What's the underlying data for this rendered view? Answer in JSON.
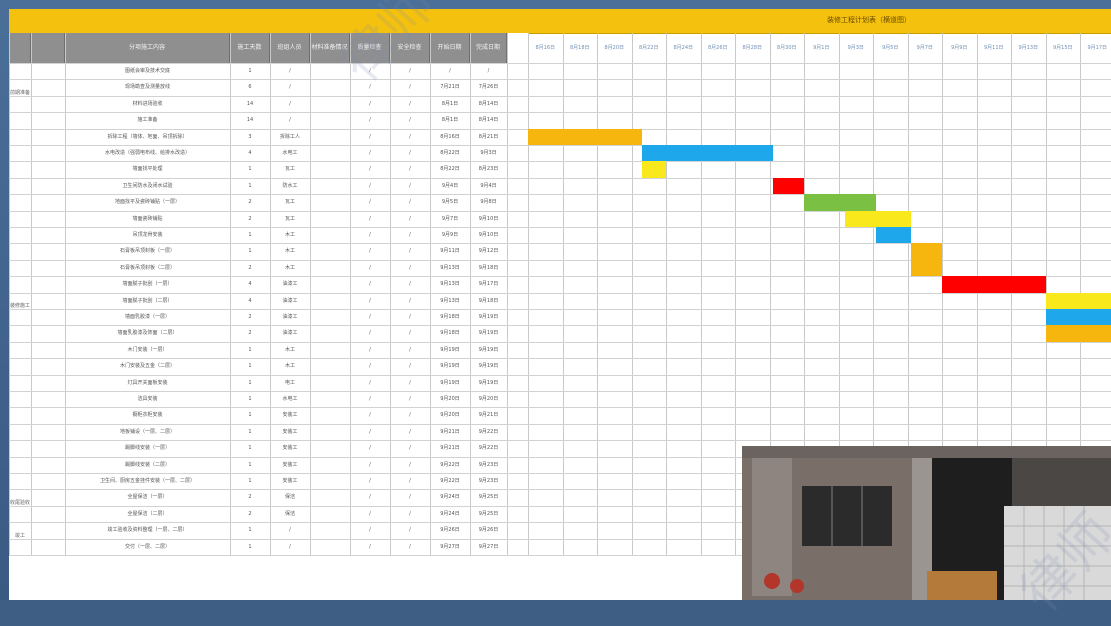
{
  "sheet": {
    "title": "装修工程计划表（横道图）",
    "columns": [
      "",
      "",
      "分项施工内容",
      "施工天数",
      "班组人员",
      "材料准备情况",
      "质量检查",
      "安全检查",
      "开始日期",
      "完成日期"
    ],
    "dates": [
      "8月16日",
      "8月18日",
      "8月20日",
      "8月22日",
      "8月24日",
      "8月26日",
      "8月28日",
      "8月30日",
      "9月1日",
      "9月3日",
      "9月5日",
      "9月7日",
      "9月9日",
      "9月11日",
      "9月13日",
      "9月15日",
      "9月17日"
    ],
    "groups": [
      {
        "label": "前期准备",
        "rows": 4
      },
      {
        "label": "装修施工",
        "rows": 22
      },
      {
        "label": "收尾验收",
        "rows": 2
      },
      {
        "label": "竣工",
        "rows": 2
      }
    ],
    "rows": [
      {
        "task": "图纸会审及技术交底",
        "days": "1",
        "crew": "/",
        "mat": "",
        "q": "/",
        "s": "/",
        "start": "/",
        "end": "/"
      },
      {
        "task": "现场勘查及测量放线",
        "days": "6",
        "crew": "/",
        "mat": "",
        "q": "/",
        "s": "/",
        "start": "7月21日",
        "end": "7月26日"
      },
      {
        "task": "材料进场验收",
        "days": "14",
        "crew": "/",
        "mat": "",
        "q": "/",
        "s": "/",
        "start": "8月1日",
        "end": "8月14日"
      },
      {
        "task": "施工准备",
        "days": "14",
        "crew": "/",
        "mat": "",
        "q": "/",
        "s": "/",
        "start": "8月1日",
        "end": "8月14日"
      },
      {
        "task": "拆除工程（墙体、地面、吊顶拆除）",
        "days": "3",
        "crew": "拆除工人",
        "mat": "",
        "q": "/",
        "s": "/",
        "start": "8月16日",
        "end": "8月21日"
      },
      {
        "task": "水电改造（强弱电布线、给排水改造）",
        "days": "4",
        "crew": "水电工",
        "mat": "",
        "q": "/",
        "s": "/",
        "start": "8月22日",
        "end": "9月3日"
      },
      {
        "task": "墙面找平处理",
        "days": "1",
        "crew": "瓦工",
        "mat": "",
        "q": "/",
        "s": "/",
        "start": "8月22日",
        "end": "8月23日"
      },
      {
        "task": "卫生间防水及闭水试验",
        "days": "1",
        "crew": "防水工",
        "mat": "",
        "q": "/",
        "s": "/",
        "start": "9月4日",
        "end": "9月4日"
      },
      {
        "task": "地面找平及瓷砖铺贴（一层）",
        "days": "2",
        "crew": "瓦工",
        "mat": "",
        "q": "/",
        "s": "/",
        "start": "9月5日",
        "end": "9月8日"
      },
      {
        "task": "墙面瓷砖铺贴",
        "days": "2",
        "crew": "瓦工",
        "mat": "",
        "q": "/",
        "s": "/",
        "start": "9月7日",
        "end": "9月10日"
      },
      {
        "task": "吊顶龙骨安装",
        "days": "1",
        "crew": "木工",
        "mat": "",
        "q": "/",
        "s": "/",
        "start": "9月9日",
        "end": "9月10日"
      },
      {
        "task": "石膏板吊顶封板（一层）",
        "days": "1",
        "crew": "木工",
        "mat": "",
        "q": "/",
        "s": "/",
        "start": "9月11日",
        "end": "9月12日"
      },
      {
        "task": "石膏板吊顶封板（二层）",
        "days": "2",
        "crew": "木工",
        "mat": "",
        "q": "/",
        "s": "/",
        "start": "9月13日",
        "end": "9月18日"
      },
      {
        "task": "墙面腻子批刮（一层）",
        "days": "4",
        "crew": "油漆工",
        "mat": "",
        "q": "/",
        "s": "/",
        "start": "9月13日",
        "end": "9月17日"
      },
      {
        "task": "墙面腻子批刮（二层）",
        "days": "4",
        "crew": "油漆工",
        "mat": "",
        "q": "/",
        "s": "/",
        "start": "9月13日",
        "end": "9月18日"
      },
      {
        "task": "墙面乳胶漆（一层）",
        "days": "2",
        "crew": "油漆工",
        "mat": "",
        "q": "/",
        "s": "/",
        "start": "9月18日",
        "end": "9月19日"
      },
      {
        "task": "墙面乳胶漆及饰面（二层）",
        "days": "2",
        "crew": "油漆工",
        "mat": "",
        "q": "/",
        "s": "/",
        "start": "9月18日",
        "end": "9月19日"
      },
      {
        "task": "木门安装（一层）",
        "days": "1",
        "crew": "木工",
        "mat": "",
        "q": "/",
        "s": "/",
        "start": "9月19日",
        "end": "9月19日"
      },
      {
        "task": "木门安装及五金（二层）",
        "days": "1",
        "crew": "木工",
        "mat": "",
        "q": "/",
        "s": "/",
        "start": "9月19日",
        "end": "9月19日"
      },
      {
        "task": "灯具开关面板安装",
        "days": "1",
        "crew": "电工",
        "mat": "",
        "q": "/",
        "s": "/",
        "start": "9月19日",
        "end": "9月19日"
      },
      {
        "task": "洁具安装",
        "days": "1",
        "crew": "水电工",
        "mat": "",
        "q": "/",
        "s": "/",
        "start": "9月20日",
        "end": "9月20日"
      },
      {
        "task": "橱柜衣柜安装",
        "days": "1",
        "crew": "安装工",
        "mat": "",
        "q": "/",
        "s": "/",
        "start": "9月20日",
        "end": "9月21日"
      },
      {
        "task": "地板铺设（一层、二层）",
        "days": "1",
        "crew": "安装工",
        "mat": "",
        "q": "/",
        "s": "/",
        "start": "9月21日",
        "end": "9月22日"
      },
      {
        "task": "踢脚线安装（一层）",
        "days": "1",
        "crew": "安装工",
        "mat": "",
        "q": "/",
        "s": "/",
        "start": "9月21日",
        "end": "9月22日"
      },
      {
        "task": "踢脚线安装（二层）",
        "days": "1",
        "crew": "安装工",
        "mat": "",
        "q": "/",
        "s": "/",
        "start": "9月22日",
        "end": "9月23日"
      },
      {
        "task": "卫生间、厨房五金挂件安装（一层、二层）",
        "days": "1",
        "crew": "安装工",
        "mat": "",
        "q": "/",
        "s": "/",
        "start": "9月22日",
        "end": "9月23日"
      },
      {
        "task": "全屋保洁（一层）",
        "days": "2",
        "crew": "保洁",
        "mat": "",
        "q": "/",
        "s": "/",
        "start": "9月24日",
        "end": "9月25日"
      },
      {
        "task": "全屋保洁（二层）",
        "days": "2",
        "crew": "保洁",
        "mat": "",
        "q": "/",
        "s": "/",
        "start": "9月24日",
        "end": "9月25日"
      },
      {
        "task": "竣工验收及资料整理（一层、二层）",
        "days": "1",
        "crew": "/",
        "mat": "",
        "q": "/",
        "s": "/",
        "start": "9月26日",
        "end": "9月26日"
      },
      {
        "task": "交付（一层、二层）",
        "days": "1",
        "crew": "/",
        "mat": "",
        "q": "/",
        "s": "/",
        "start": "9月27日",
        "end": "9月27日"
      }
    ],
    "bars": [
      {
        "row": 4,
        "col_start": 0,
        "cols": 3.3,
        "color": "#f6b60e"
      },
      {
        "row": 5,
        "col_start": 3.3,
        "cols": 3.8,
        "color": "#1ea7ea"
      },
      {
        "row": 6,
        "col_start": 3.3,
        "cols": 0.7,
        "color": "#f8e81c"
      },
      {
        "row": 7,
        "col_start": 7.1,
        "cols": 0.9,
        "color": "#ff0000"
      },
      {
        "row": 8,
        "col_start": 8.0,
        "cols": 2.1,
        "color": "#7ac143"
      },
      {
        "row": 9,
        "col_start": 9.2,
        "cols": 1.9,
        "color": "#f8e81c"
      },
      {
        "row": 10,
        "col_start": 10.1,
        "cols": 1.0,
        "color": "#1ea7ea"
      },
      {
        "row": 11,
        "col_start": 11.1,
        "cols": 0.9,
        "color": "#f6b60e"
      },
      {
        "row": 12,
        "col_start": 11.1,
        "cols": 0.9,
        "color": "#f6b60e"
      },
      {
        "row": 13,
        "col_start": 12.0,
        "cols": 3.0,
        "color": "#ff0000"
      },
      {
        "row": 14,
        "col_start": 15.0,
        "cols": 2.0,
        "color": "#f8e81c"
      },
      {
        "row": 15,
        "col_start": 15.0,
        "cols": 2.0,
        "color": "#1ea7ea"
      },
      {
        "row": 16,
        "col_start": 15.0,
        "cols": 2.0,
        "color": "#f6b60e"
      }
    ],
    "watermark": "律师"
  }
}
